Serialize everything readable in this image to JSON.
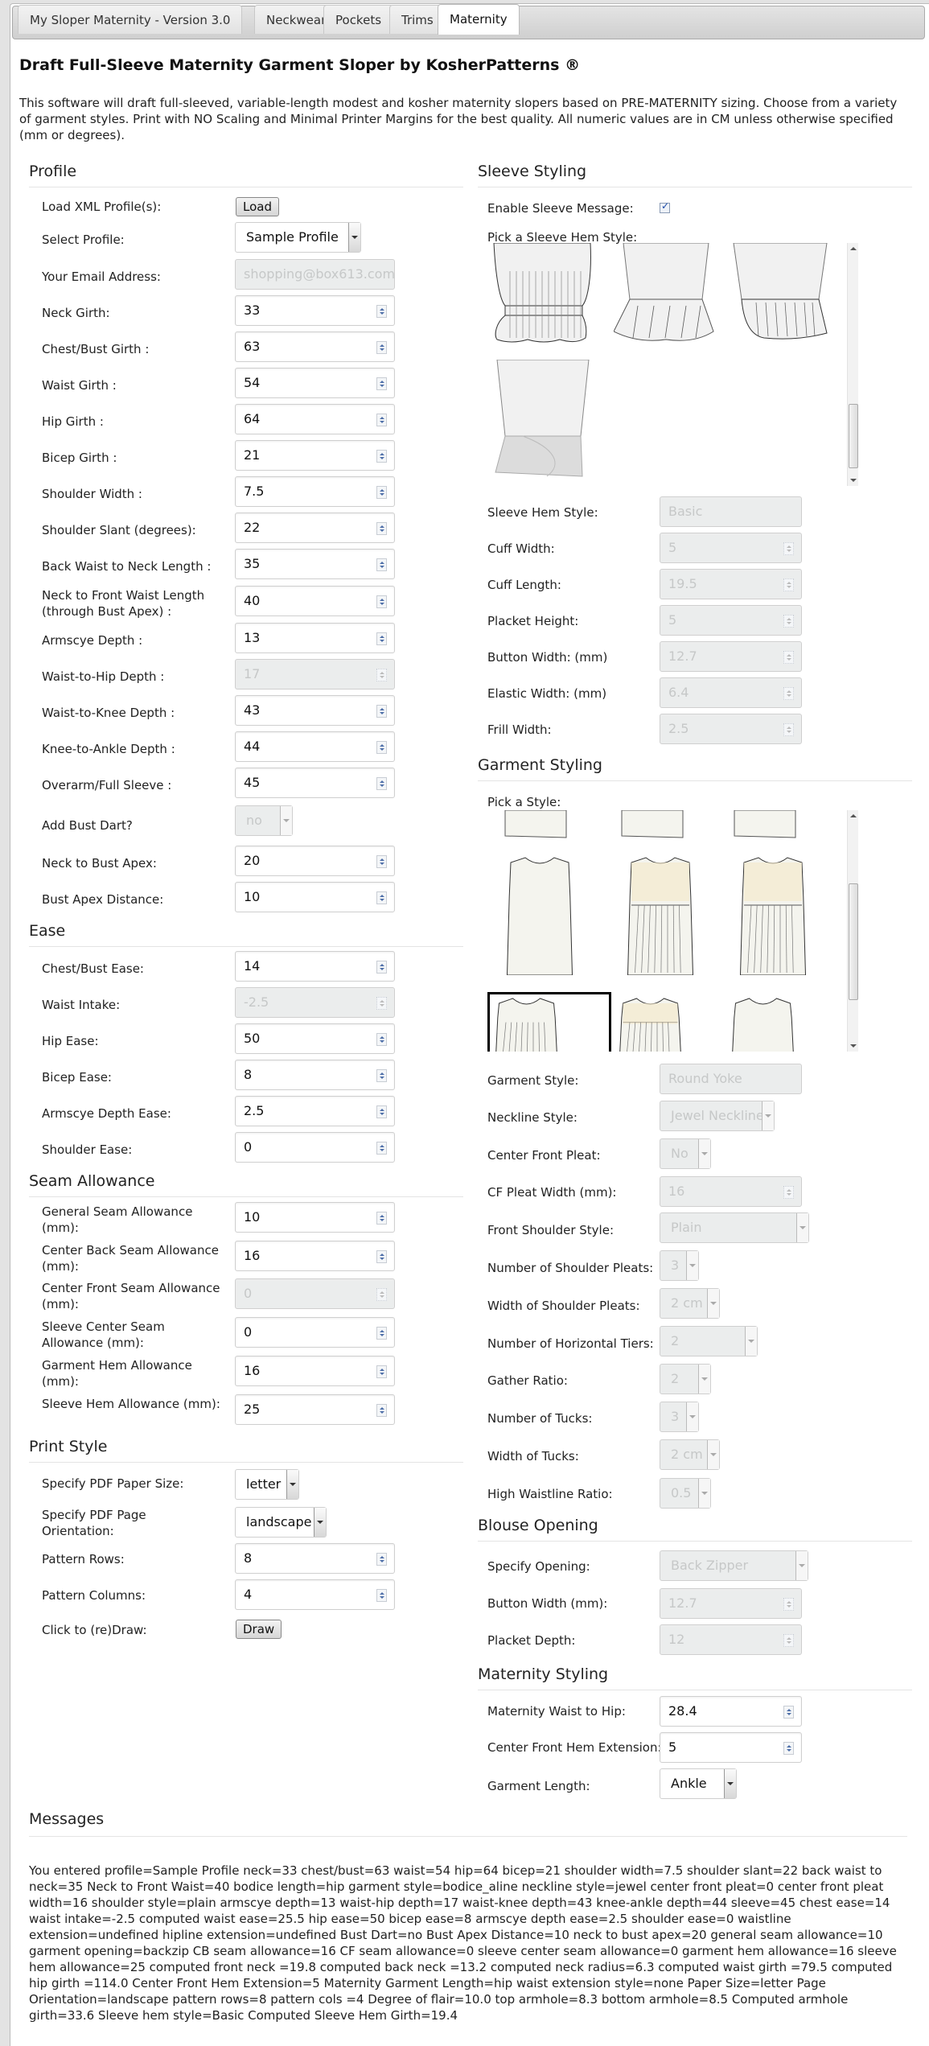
{
  "tabs": [
    {
      "label": "My Sloper Maternity - Version 3.0",
      "active": false
    },
    {
      "label": "Neckwear",
      "active": false
    },
    {
      "label": "Pockets",
      "active": false
    },
    {
      "label": "Trims",
      "active": false
    },
    {
      "label": "Maternity",
      "active": true
    }
  ],
  "page": {
    "title": "Draft Full-Sleeve Maternity Garment Sloper by KosherPatterns ®",
    "intro": "This software will draft full-sleeved, variable-length modest and kosher maternity slopers based on PRE-MATERNITY sizing. Choose from a variety of garment styles. Print with NO Scaling and Minimal Printer Margins for the best quality. All numeric values are in CM unless otherwise specified (mm or degrees)."
  },
  "profile": {
    "heading": "Profile",
    "load_label": "Load XML Profile(s):",
    "load_button": "Load",
    "select_label": "Select Profile:",
    "select_value": "Sample Profile",
    "email_label": "Your Email Address:",
    "email_placeholder": "shopping@box613.com",
    "fields": [
      {
        "label": "Neck Girth:",
        "value": "33",
        "disabled": false
      },
      {
        "label": "Chest/Bust Girth :",
        "value": "63",
        "disabled": false
      },
      {
        "label": "Waist Girth :",
        "value": "54",
        "disabled": false
      },
      {
        "label": "Hip Girth :",
        "value": "64",
        "disabled": false
      },
      {
        "label": "Bicep Girth :",
        "value": "21",
        "disabled": false
      },
      {
        "label": "Shoulder Width :",
        "value": "7.5",
        "disabled": false
      },
      {
        "label": "Shoulder Slant (degrees):",
        "value": "22",
        "disabled": false
      },
      {
        "label": "Back Waist to Neck Length :",
        "value": "35",
        "disabled": false
      },
      {
        "label": "Neck to Front Waist Length (through Bust Apex) :",
        "value": "40",
        "disabled": false
      },
      {
        "label": "Armscye Depth :",
        "value": "13",
        "disabled": false
      },
      {
        "label": "Waist-to-Hip Depth :",
        "value": "17",
        "disabled": true
      },
      {
        "label": "Waist-to-Knee Depth :",
        "value": "43",
        "disabled": false
      },
      {
        "label": "Knee-to-Ankle Depth :",
        "value": "44",
        "disabled": false
      },
      {
        "label": "Overarm/Full Sleeve :",
        "value": "45",
        "disabled": false
      }
    ],
    "bust_dart_label": "Add Bust Dart?",
    "bust_dart_value": "no",
    "fields2": [
      {
        "label": "Neck to Bust Apex:",
        "value": "20"
      },
      {
        "label": "Bust Apex Distance:",
        "value": "10"
      }
    ]
  },
  "ease": {
    "heading": "Ease",
    "fields": [
      {
        "label": "Chest/Bust Ease:",
        "value": "14",
        "disabled": false
      },
      {
        "label": "Waist Intake:",
        "value": "-2.5",
        "disabled": true
      },
      {
        "label": "Hip Ease:",
        "value": "50",
        "disabled": false
      },
      {
        "label": "Bicep Ease:",
        "value": "8",
        "disabled": false
      },
      {
        "label": "Armscye Depth Ease:",
        "value": "2.5",
        "disabled": false
      },
      {
        "label": "Shoulder Ease:",
        "value": "0",
        "disabled": false
      }
    ]
  },
  "seam": {
    "heading": "Seam Allowance",
    "fields": [
      {
        "label": "General Seam Allowance (mm):",
        "value": "10",
        "disabled": false
      },
      {
        "label": "Center Back Seam Allowance (mm):",
        "value": "16",
        "disabled": false
      },
      {
        "label": "Center Front Seam Allowance (mm):",
        "value": "0",
        "disabled": true
      },
      {
        "label": "Sleeve Center Seam Allowance (mm):",
        "value": "0",
        "disabled": false
      },
      {
        "label": "Garment Hem Allowance (mm):",
        "value": "16",
        "disabled": false
      },
      {
        "label": "Sleeve Hem Allowance (mm):",
        "value": "25",
        "disabled": false
      }
    ]
  },
  "print": {
    "heading": "Print Style",
    "paper_label": "Specify PDF Paper Size:",
    "paper_value": "letter",
    "orient_label": "Specify PDF Page Orientation:",
    "orient_value": "landscape",
    "rows_label": "Pattern Rows:",
    "rows_value": "8",
    "cols_label": "Pattern Columns:",
    "cols_value": "4",
    "draw_label": "Click to (re)Draw:",
    "draw_button": "Draw"
  },
  "sleeve": {
    "heading": "Sleeve Styling",
    "message_label": "Enable Sleeve Message:",
    "message_checked": true,
    "pick_label": "Pick a Sleeve Hem Style:",
    "thumbnails": [
      "Elastic gathered cuff",
      "Peplum frill",
      "Side frill",
      "Wrap cuff"
    ],
    "hem_style_label": "Sleeve Hem Style:",
    "hem_style_value": "Basic",
    "fields": [
      {
        "label": "Cuff Width:",
        "value": "5"
      },
      {
        "label": "Cuff Length:",
        "value": "19.5"
      },
      {
        "label": "Placket Height:",
        "value": "5"
      },
      {
        "label": "Button Width: (mm)",
        "value": "12.7"
      },
      {
        "label": "Elastic Width: (mm)",
        "value": "6.4"
      },
      {
        "label": "Frill Width:",
        "value": "2.5"
      }
    ]
  },
  "garment": {
    "heading": "Garment Styling",
    "pick_label": "Pick a Style:",
    "thumbnails": [
      "Style A",
      "Style B",
      "Style C",
      "Shift dress",
      "Smocked bodice gathered",
      "Smocked bodice flared",
      "Round Yoke",
      "Straight yoke gathers",
      "Shoulder pleats"
    ],
    "style_label": "Garment Style:",
    "style_value": "Round Yoke",
    "neckline_label": "Neckline Style:",
    "neckline_value": "Jewel Neckline",
    "cf_pleat_label": "Center Front Pleat:",
    "cf_pleat_value": "No",
    "cf_pleat_width_label": "CF Pleat Width (mm):",
    "cf_pleat_width_value": "16",
    "shoulder_style_label": "Front Shoulder Style:",
    "shoulder_style_value": "Plain",
    "num_shoulder_pleats_label": "Number of Shoulder Pleats:",
    "num_shoulder_pleats_value": "3",
    "width_shoulder_pleats_label": "Width of Shoulder Pleats:",
    "width_shoulder_pleats_value": "2 cm",
    "tiers_label": "Number of Horizontal Tiers:",
    "tiers_value": "2",
    "gather_label": "Gather Ratio:",
    "gather_value": "2",
    "tucks_label": "Number of Tucks:",
    "tucks_value": "3",
    "tuck_width_label": "Width of Tucks:",
    "tuck_width_value": "2 cm",
    "high_waist_label": "High Waistline Ratio:",
    "high_waist_value": "0.5"
  },
  "blouse": {
    "heading": "Blouse Opening",
    "opening_label": "Specify Opening:",
    "opening_value": "Back Zipper",
    "button_width_label": "Button Width (mm):",
    "button_width_value": "12.7",
    "placket_label": "Placket Depth:",
    "placket_value": "12"
  },
  "maternity": {
    "heading": "Maternity Styling",
    "waist_hip_label": "Maternity Waist to Hip:",
    "waist_hip_value": "28.4",
    "cf_hem_label": "Center Front Hem Extension:",
    "cf_hem_value": "5",
    "length_label": "Garment Length:",
    "length_value": "Ankle"
  },
  "messages": {
    "heading": "Messages",
    "text": "You entered profile=Sample Profile neck=33 chest/bust=63 waist=54 hip=64 bicep=21 shoulder width=7.5 shoulder slant=22 back waist to neck=35 Neck to Front Waist=40 bodice length=hip garment style=bodice_aline neckline style=jewel center front pleat=0 center front pleat width=16 shoulder style=plain armscye depth=13 waist-hip depth=17 waist-knee depth=43 knee-ankle depth=44 sleeve=45 chest ease=14 waist intake=-2.5 computed waist ease=25.5 hip ease=50 bicep ease=8 armscye depth ease=2.5 shoulder ease=0 waistline extension=undefined hipline extension=undefined Bust Dart=no Bust Apex Distance=10 neck to bust apex=20 general seam allowance=10 garment opening=backzip CB seam allowance=16 CF seam allowance=0 sleeve center seam allowance=0 garment hem allowance=16 sleeve hem allowance=25 computed front neck =19.8 computed back neck =13.2 computed neck radius=6.3 computed waist girth =79.5 computed hip girth =114.0 Center Front Hem Extension=5 Maternity Garment Length=hip waist extension style=none Paper Size=letter Page Orientation=landscape pattern rows=8 pattern cols =4 Degree of flair=10.0 top armhole=8.3 bottom armhole=8.5 Computed armhole girth=33.6 Sleeve hem style=Basic Computed Sleeve Hem Girth=19.4"
  }
}
